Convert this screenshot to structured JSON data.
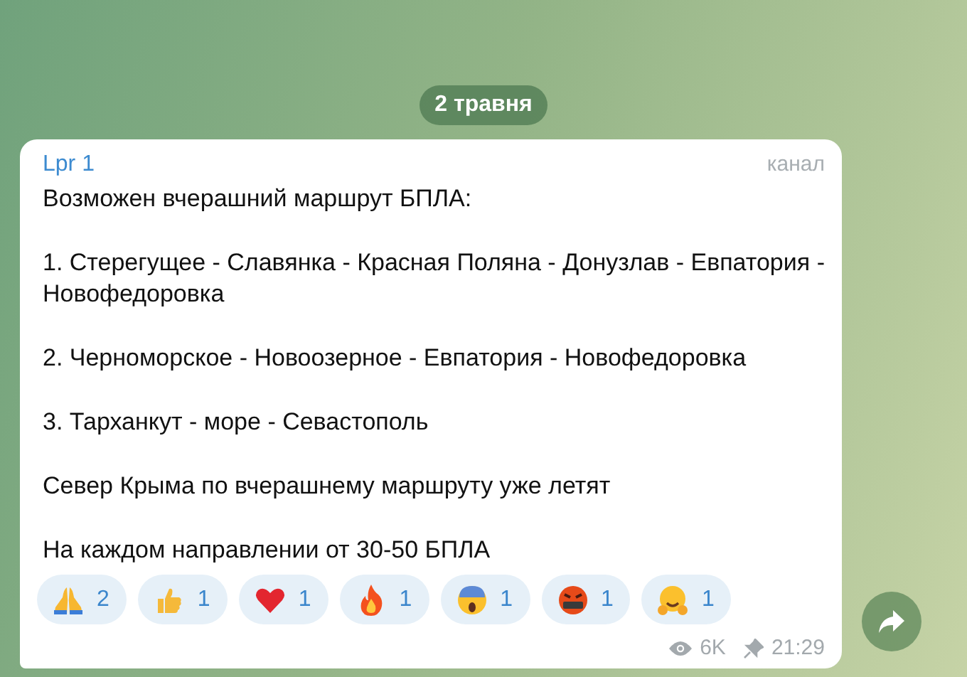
{
  "date_pill": "2 травня",
  "message": {
    "channel_name": "Lpr 1",
    "sender_label": "канал",
    "paragraphs": [
      "Возможен вчерашний маршрут БПЛА:",
      "1. Стерегущее - Славянка - Красная Поляна - Донузлав - Евпатория - Новофедоровка",
      "2. Черноморское - Новоозерное - Евпатория - Новофедоровка",
      "3. Тарханкут - море - Севастополь",
      "Север Крыма по вчерашнему маршруту уже летят",
      "На каждом направлении от 30-50 БПЛА"
    ],
    "reactions": [
      {
        "kind": "pray",
        "count": "2"
      },
      {
        "kind": "thumbs-up",
        "count": "1"
      },
      {
        "kind": "heart",
        "count": "1"
      },
      {
        "kind": "fire",
        "count": "1"
      },
      {
        "kind": "scream",
        "count": "1"
      },
      {
        "kind": "swear",
        "count": "1"
      },
      {
        "kind": "hug",
        "count": "1"
      }
    ],
    "views": "6K",
    "pinned": true,
    "time": "21:29"
  }
}
